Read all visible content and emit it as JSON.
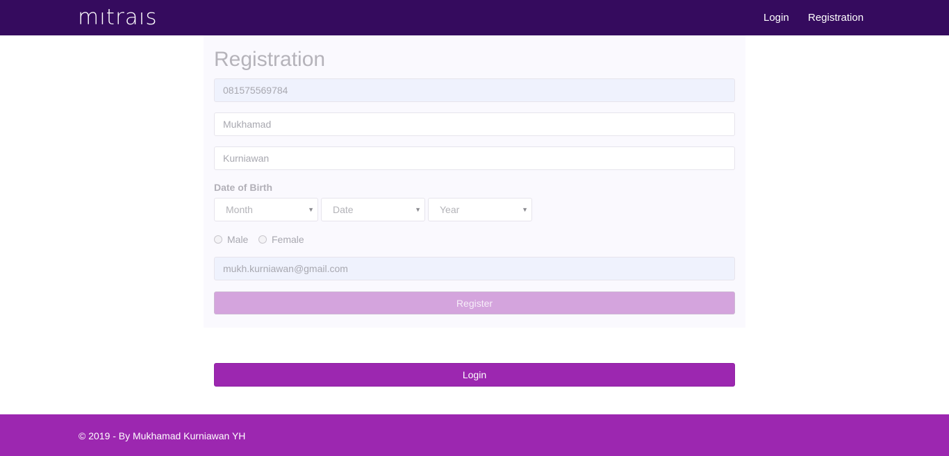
{
  "navbar": {
    "logo": "mıtraıs",
    "links": [
      "Login",
      "Registration"
    ]
  },
  "form": {
    "title": "Registration",
    "mobile_value": "081575569784",
    "first_name_value": "Mukhamad",
    "last_name_value": "Kurniawan",
    "dob_label": "Date of Birth",
    "month_placeholder": "Month",
    "date_placeholder": "Date",
    "year_placeholder": "Year",
    "gender_options": [
      "Male",
      "Female"
    ],
    "email_value": "mukh.kurniawan@gmail.com",
    "register_label": "Register"
  },
  "login_button_label": "Login",
  "footer": {
    "text": "© 2019 - By Mukhamad Kurniawan YH"
  },
  "colors": {
    "navbar": "#350b5e",
    "accent": "#9c27b0",
    "register_disabled": "#d4a4dd"
  }
}
